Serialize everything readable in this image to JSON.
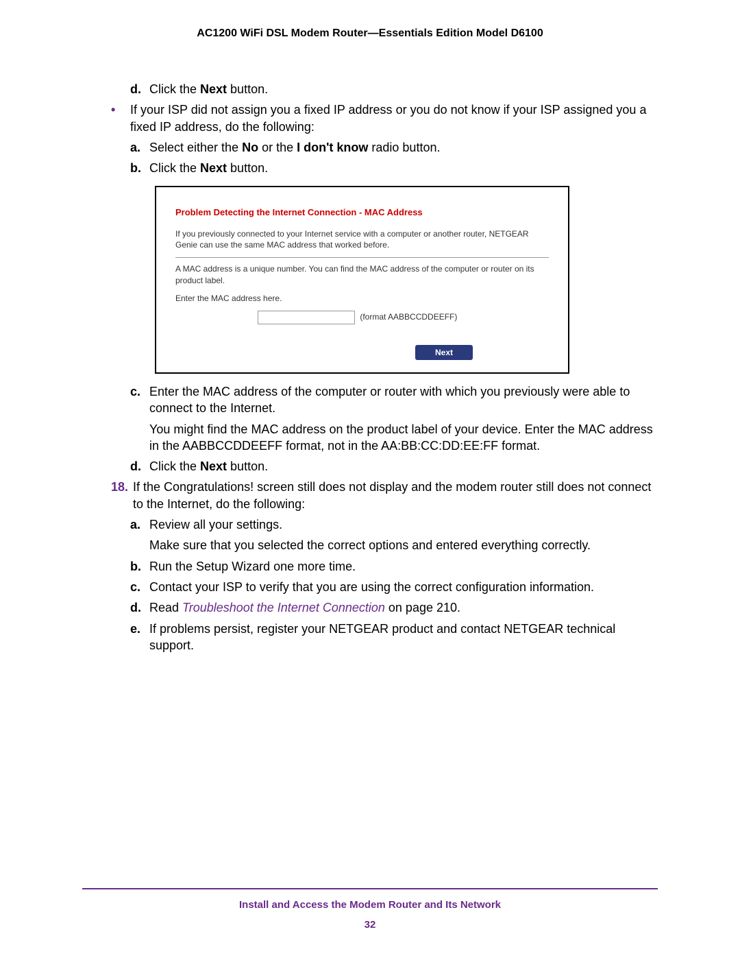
{
  "header": "AC1200 WiFi DSL Modem Router—Essentials Edition Model D6100",
  "step_d_top": {
    "label": "d.",
    "prefix": "Click the ",
    "bold": "Next",
    "suffix": " button."
  },
  "bullet_intro": "If your ISP did not assign you a fixed IP address or you do not know if your ISP assigned you a fixed IP address, do the following:",
  "step_a1": {
    "label": "a.",
    "prefix": "Select either the ",
    "bold1": "No",
    "mid": " or the ",
    "bold2": "I don't know",
    "suffix": " radio button."
  },
  "step_b1": {
    "label": "b.",
    "prefix": "Click the ",
    "bold": "Next",
    "suffix": " button."
  },
  "screenshot": {
    "title": "Problem Detecting the Internet Connection - MAC Address",
    "para1": "If you previously connected to your Internet service with a computer or another router, NETGEAR Genie can use the same MAC address that worked before.",
    "para2": "A MAC address is a unique number. You can find the MAC address of the computer or router on its product label.",
    "prompt": "Enter the MAC address here.",
    "hint": "(format AABBCCDDEEFF)",
    "button": "Next"
  },
  "step_c1": {
    "label": "c.",
    "text": "Enter the MAC address of the computer or router with which you previously were able to connect to the Internet.",
    "note": "You might find the MAC address on the product label of your device. Enter the MAC address in the AABBCCDDEEFF format, not in the AA:BB:CC:DD:EE:FF format."
  },
  "step_d2": {
    "label": "d.",
    "prefix": "Click the ",
    "bold": "Next",
    "suffix": " button."
  },
  "step18": {
    "label": "18.",
    "text": "If the Congratulations! screen still does not display and the modem router still does not connect to the Internet, do the following:"
  },
  "step_a2": {
    "label": "a.",
    "text": "Review all your settings.",
    "note": "Make sure that you selected the correct options and entered everything correctly."
  },
  "step_b2": {
    "label": "b.",
    "text": "Run the Setup Wizard one more time."
  },
  "step_c2": {
    "label": "c.",
    "text": "Contact your ISP to verify that you are using the correct configuration information."
  },
  "step_d3": {
    "label": "d.",
    "prefix": "Read ",
    "link": "Troubleshoot the Internet Connection",
    "suffix": " on page 210."
  },
  "step_e": {
    "label": "e.",
    "text": "If problems persist, register your NETGEAR product and contact NETGEAR technical support."
  },
  "footer": {
    "text": "Install and Access the Modem Router and Its Network",
    "page": "32"
  }
}
